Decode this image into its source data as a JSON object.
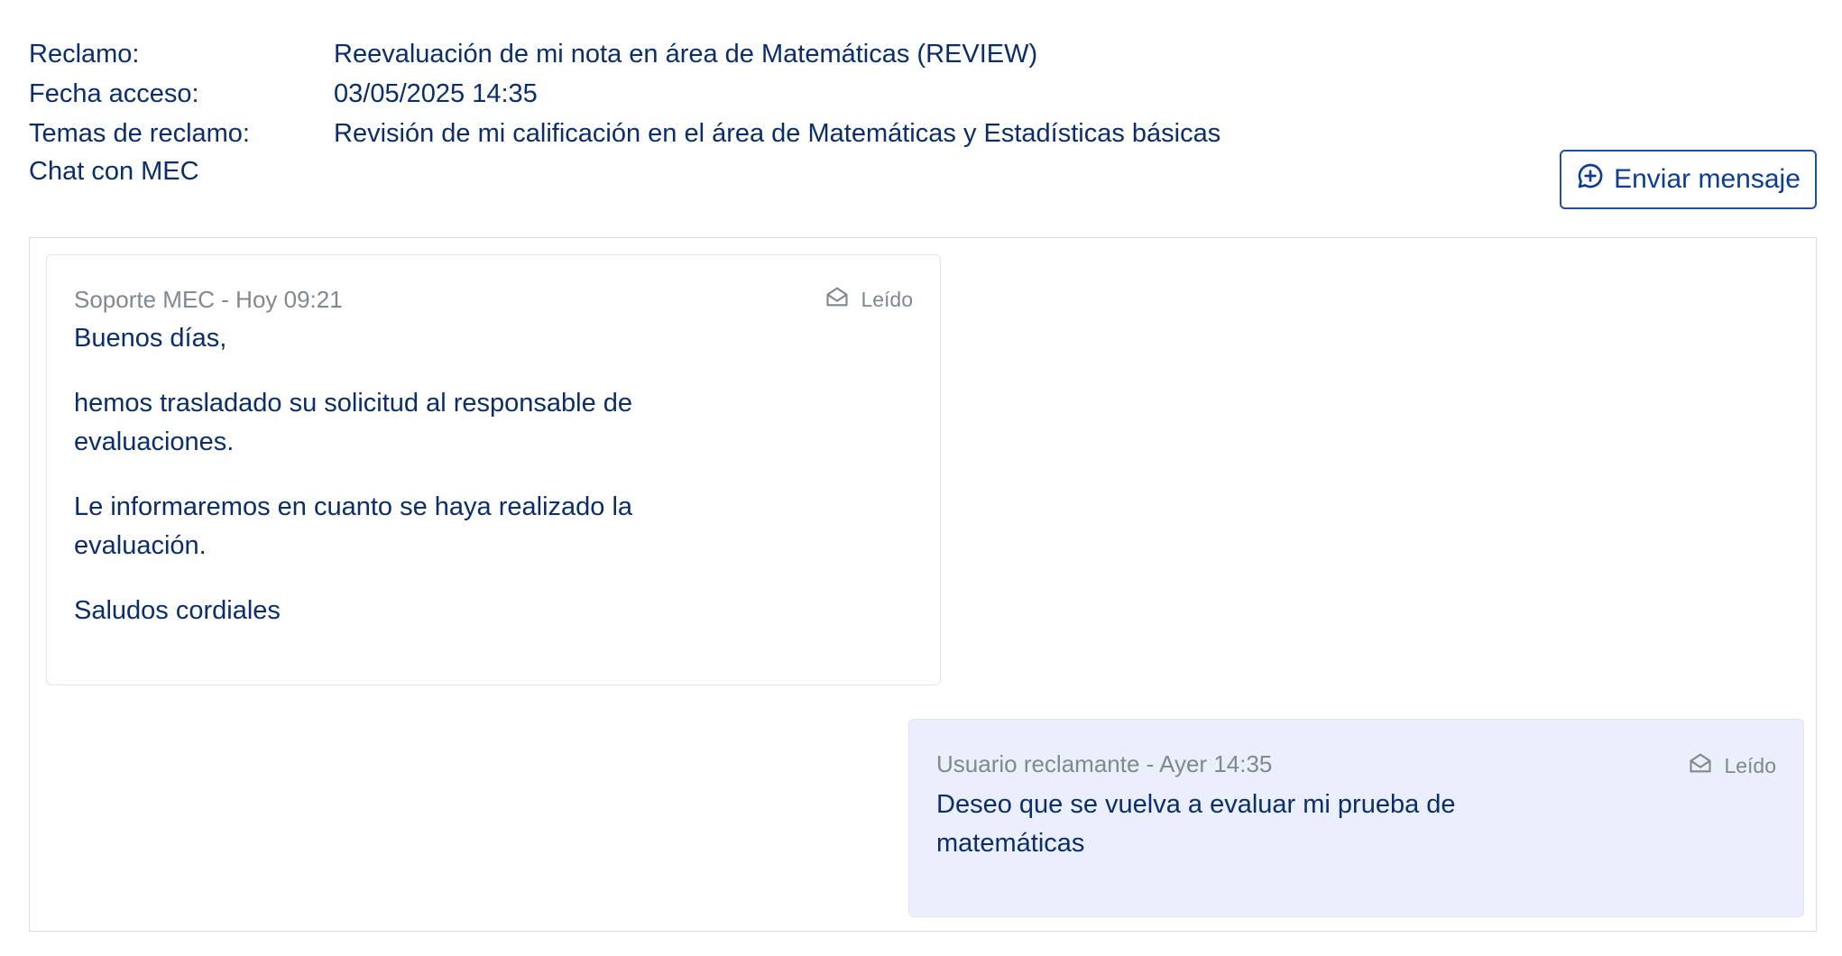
{
  "header": {
    "rows": [
      {
        "label": "Reclamo:",
        "value": "Reevaluación de mi nota en área de Matemáticas (REVIEW)"
      },
      {
        "label": "Fecha acceso:",
        "value": "03/05/2025 14:35"
      },
      {
        "label": "Temas de reclamo:",
        "value": "Revisión de mi calificación en el área de Matemáticas y Estadísticas básicas"
      }
    ],
    "chat_title": "Chat con MEC",
    "send_button": "Enviar mensaje"
  },
  "messages": [
    {
      "meta": "Soporte MEC - Hoy 09:21",
      "status": "Leído",
      "paragraphs": [
        "Buenos días,",
        "hemos trasladado su solicitud al responsable de evaluaciones.",
        "Le informaremos en cuanto se haya realizado la evaluación.",
        "Saludos cordiales"
      ]
    },
    {
      "meta": "Usuario reclamante - Ayer 14:35",
      "status": "Leído",
      "paragraphs": [
        "Deseo que se vuelva a evaluar mi prueba de matemáticas"
      ]
    }
  ],
  "icons": {
    "send": "chat-plus-icon",
    "read": "envelope-open-icon"
  },
  "colors": {
    "text": "#0b2e6b",
    "meta": "#808890",
    "user_bubble": "#eaeffb",
    "button_border": "#1f4f9e"
  }
}
